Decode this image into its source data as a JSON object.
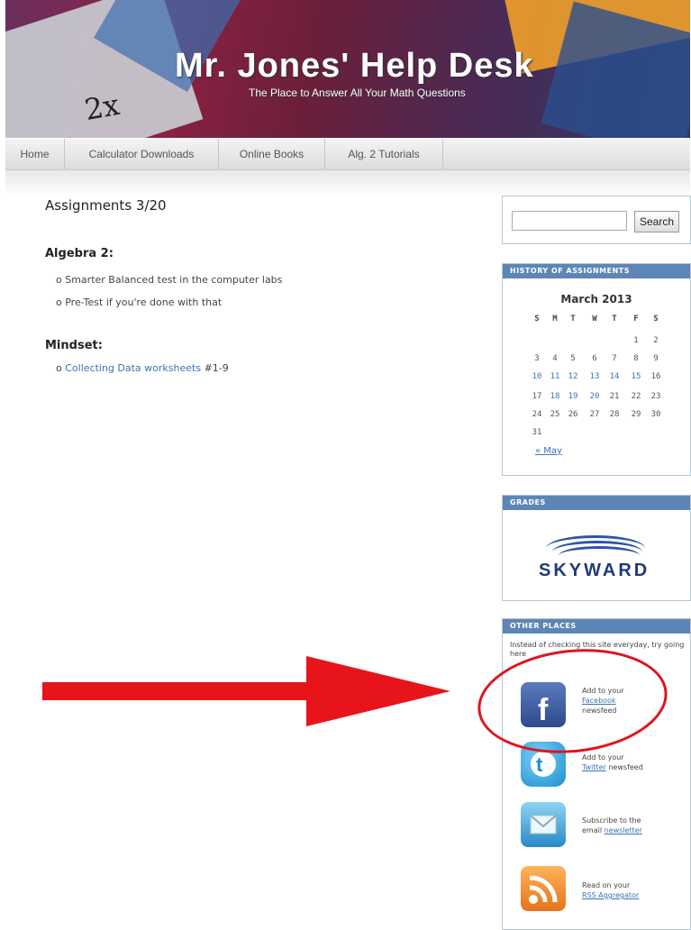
{
  "header": {
    "title": "Mr. Jones' Help Desk",
    "tagline": "The Place to Answer All Your Math Questions",
    "deco": "2x"
  },
  "nav": {
    "items": [
      "Home",
      "Calculator Downloads",
      "Online Books",
      "Alg. 2 Tutorials"
    ]
  },
  "post": {
    "title": "Assignments 3/20",
    "sections": [
      {
        "heading": "Algebra 2:",
        "items": [
          "Smarter Balanced test in the computer labs",
          "Pre-Test if you're done with that"
        ]
      },
      {
        "heading": "Mindset:",
        "link_text": "Collecting Data worksheets",
        "link_suffix": "#1-9"
      }
    ]
  },
  "sidebar": {
    "search_button": "Search",
    "history": {
      "title": "HISTORY OF ASSIGNMENTS",
      "caption": "March 2013",
      "weekdays": [
        "S",
        "M",
        "T",
        "W",
        "T",
        "F",
        "S"
      ],
      "weeks": [
        [
          "",
          "",
          "",
          "",
          "",
          "1",
          "2"
        ],
        [
          "3",
          "4",
          "5",
          "6",
          "7",
          "8",
          "9"
        ],
        [
          "10",
          "11",
          "12",
          "13",
          "14",
          "15",
          "16"
        ],
        [
          "17",
          "18",
          "19",
          "20",
          "21",
          "22",
          "23"
        ],
        [
          "24",
          "25",
          "26",
          "27",
          "28",
          "29",
          "30"
        ],
        [
          "31",
          "",
          "",
          "",
          "",
          "",
          ""
        ]
      ],
      "linked_days": [
        "10",
        "11",
        "12",
        "13",
        "14",
        "15",
        "18",
        "19",
        "20"
      ],
      "prev_link": "« May"
    },
    "grades": {
      "title": "GRADES",
      "logo_text": "SKYWARD"
    },
    "other_places": {
      "title": "OTHER PLACES",
      "intro": "Instead of checking this site everyday, try going here",
      "entries": [
        {
          "icon": "facebook-icon",
          "line1": "Add to your",
          "link": "Facebook",
          "line2": "newsfeed"
        },
        {
          "icon": "twitter-icon",
          "line1": "Add to your",
          "link": "Twitter",
          "line2": "newsfeed"
        },
        {
          "icon": "email-icon",
          "line1": "Subscribe to the",
          "line2": "email",
          "link": "newsletter"
        },
        {
          "icon": "rss-icon",
          "line1": "Read on your",
          "link": "RSS Aggregator"
        }
      ]
    }
  },
  "colors": {
    "accent": "#5d86b7",
    "link": "#3a73b8",
    "annotation": "#e8141c"
  }
}
